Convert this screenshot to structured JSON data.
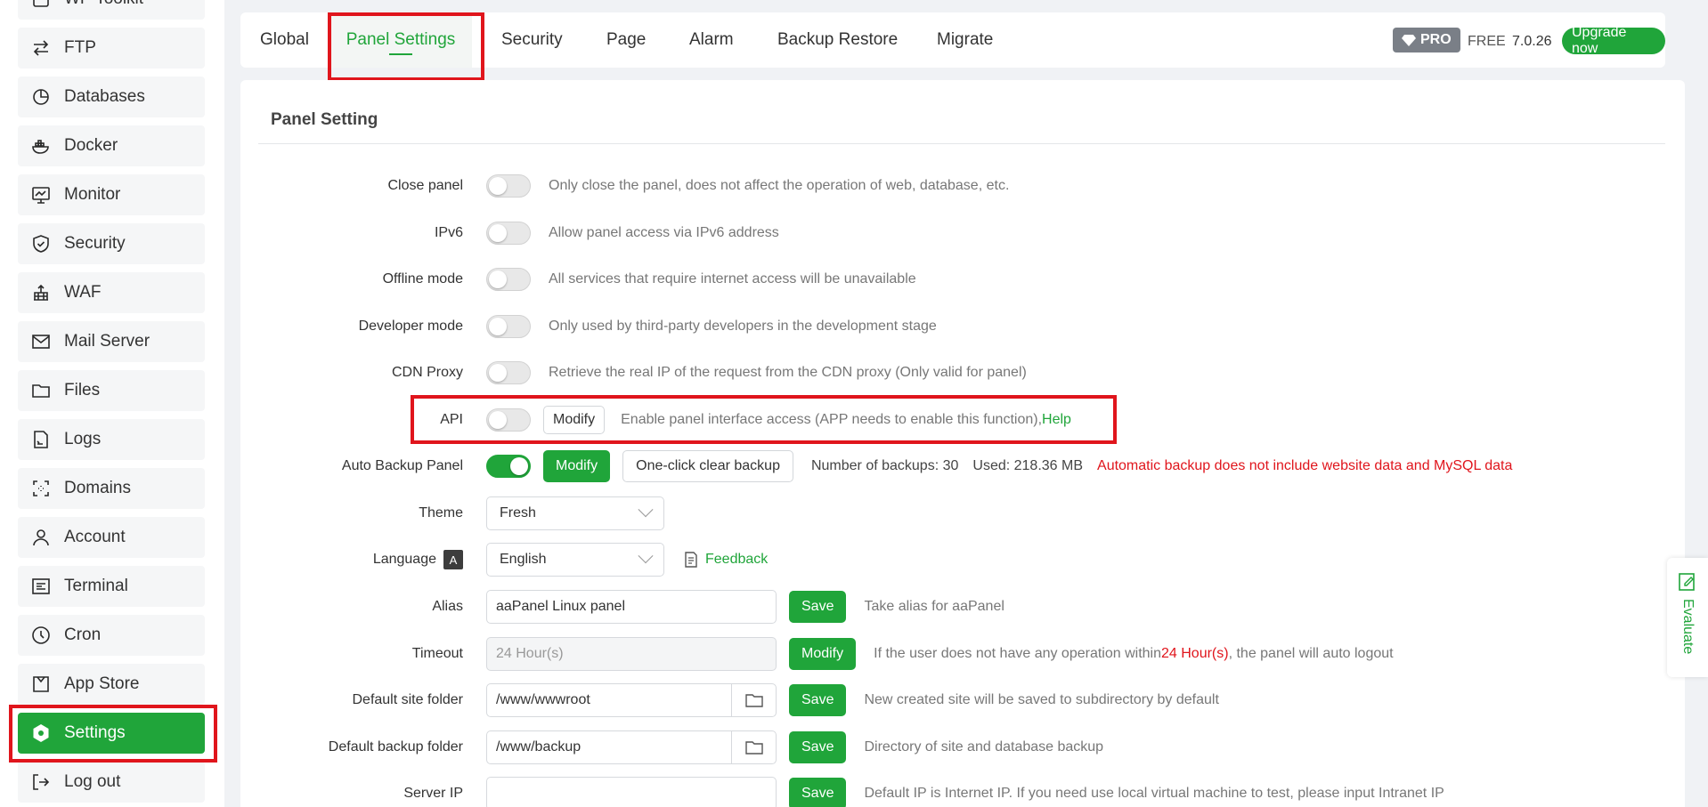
{
  "sidebar": {
    "items": [
      {
        "label": "WP Toolkit",
        "icon": "wp-toolkit-icon"
      },
      {
        "label": "FTP",
        "icon": "ftp-icon"
      },
      {
        "label": "Databases",
        "icon": "database-icon"
      },
      {
        "label": "Docker",
        "icon": "docker-icon"
      },
      {
        "label": "Monitor",
        "icon": "monitor-icon"
      },
      {
        "label": "Security",
        "icon": "shield-icon"
      },
      {
        "label": "WAF",
        "icon": "waf-icon"
      },
      {
        "label": "Mail Server",
        "icon": "mail-icon"
      },
      {
        "label": "Files",
        "icon": "folder-icon"
      },
      {
        "label": "Logs",
        "icon": "logs-icon"
      },
      {
        "label": "Domains",
        "icon": "domains-icon"
      },
      {
        "label": "Account",
        "icon": "user-icon"
      },
      {
        "label": "Terminal",
        "icon": "terminal-icon"
      },
      {
        "label": "Cron",
        "icon": "clock-icon"
      },
      {
        "label": "App Store",
        "icon": "store-icon"
      },
      {
        "label": "Settings",
        "icon": "gear-icon"
      },
      {
        "label": "Log out",
        "icon": "logout-icon"
      }
    ],
    "active": "Settings"
  },
  "tabs": [
    {
      "label": "Global"
    },
    {
      "label": "Panel Settings"
    },
    {
      "label": "Security"
    },
    {
      "label": "Page"
    },
    {
      "label": "Alarm"
    },
    {
      "label": "Backup Restore"
    },
    {
      "label": "Migrate"
    }
  ],
  "header": {
    "pro_label": "PRO",
    "free_label": "FREE",
    "version": "7.0.26",
    "upgrade_label": "Upgrade now"
  },
  "panel": {
    "title": "Panel Setting",
    "close_panel": {
      "label": "Close panel",
      "enabled": false,
      "desc": "Only close the panel, does not affect the operation of web, database, etc."
    },
    "ipv6": {
      "label": "IPv6",
      "enabled": false,
      "desc": "Allow panel access via IPv6 address"
    },
    "offline": {
      "label": "Offline mode",
      "enabled": false,
      "desc": "All services that require internet access will be unavailable"
    },
    "developer": {
      "label": "Developer mode",
      "enabled": false,
      "desc": "Only used by third-party developers in the development stage"
    },
    "cdn": {
      "label": "CDN Proxy",
      "enabled": false,
      "desc": "Retrieve the real IP of the request from the CDN proxy  (Only valid for panel)"
    },
    "api": {
      "label": "API",
      "enabled": false,
      "modify_label": "Modify",
      "desc": "Enable panel interface access (APP needs to enable this function),",
      "help_label": "Help"
    },
    "auto_backup": {
      "label": "Auto Backup Panel",
      "enabled": true,
      "modify_label": "Modify",
      "clear_label": "One-click clear backup",
      "count_text": "Number of backups:  30",
      "used_text": "Used:  218.36 MB",
      "warning": "Automatic backup does not include website data and MySQL data"
    },
    "theme": {
      "label": "Theme",
      "value": "Fresh"
    },
    "language": {
      "label": "Language",
      "value": "English",
      "feedback_label": "Feedback"
    },
    "alias": {
      "label": "Alias",
      "value": "aaPanel Linux panel",
      "save_label": "Save",
      "desc": "Take alias for aaPanel"
    },
    "timeout": {
      "label": "Timeout",
      "placeholder": "24 Hour(s)",
      "modify_label": "Modify",
      "desc_pre": "If the user does not have any operation within",
      "desc_hl": "24 Hour(s)",
      "desc_post": ", the panel will auto logout"
    },
    "site_folder": {
      "label": "Default site folder",
      "value": "/www/wwwroot",
      "save_label": "Save",
      "desc": "New created site will be saved to subdirectory by default"
    },
    "backup_folder": {
      "label": "Default backup folder",
      "value": "/www/backup",
      "save_label": "Save",
      "desc": "Directory of site and database backup"
    },
    "server_ip": {
      "label": "Server IP",
      "value": "",
      "save_label": "Save",
      "desc": "Default IP is Internet IP. If you need use local virtual machine to test, please input Intranet IP"
    }
  },
  "evaluate_label": "Evaluate",
  "colors": {
    "accent": "#20a53a",
    "highlight": "#e0151c"
  }
}
